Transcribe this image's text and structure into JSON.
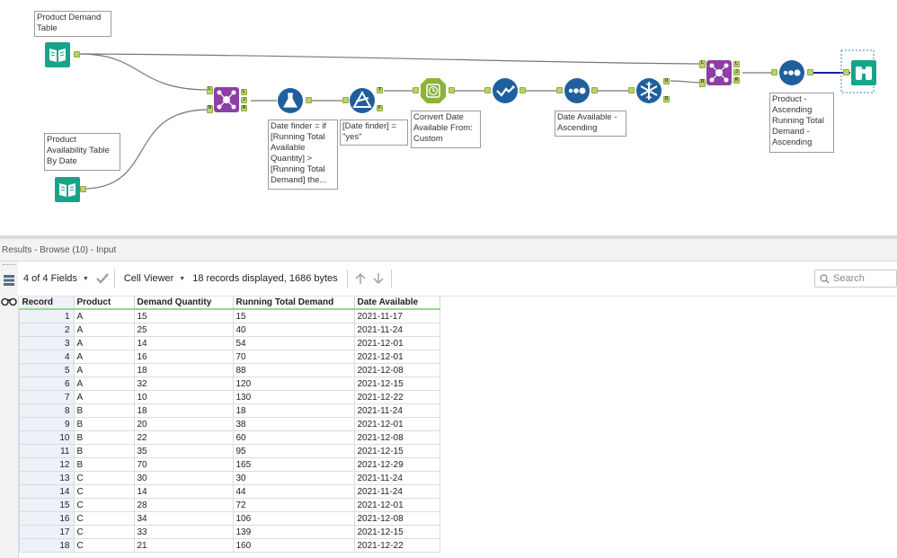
{
  "workflow": {
    "annotations": {
      "input1": "Product Demand Table",
      "input2": "Product Availability Table By Date",
      "formula": "Date finder = if [Running Total Available Quantity] > [Running Total Demand] the...",
      "filter": "[Date finder] = \"yes\"",
      "datetime": "Convert Date Available From: Custom",
      "sort1": "Date Available - Ascending",
      "sort2": "Product - Ascending Running Total Demand - Ascending"
    },
    "anchors": {
      "L": "L",
      "R": "R",
      "J": "J",
      "T": "T",
      "F": "F",
      "U": "U",
      "D": "D"
    },
    "colors": {
      "input": "#17a589",
      "join": "#8e3fa5",
      "blue": "#1f5f9e",
      "datetime": "#8bb33a",
      "wire": "#777777",
      "wire_selected": "#1d1f9b"
    }
  },
  "results": {
    "title": "Results - Browse (10) - Input",
    "toolbar": {
      "fields": "4 of 4 Fields",
      "viewer": "Cell Viewer",
      "records": "18 records displayed, 1686 bytes",
      "search_placeholder": "Search"
    },
    "columns": [
      "Record",
      "Product",
      "Demand Quantity",
      "Running Total Demand",
      "Date Available"
    ],
    "rows": [
      [
        "1",
        "A",
        "15",
        "15",
        "2021-11-17"
      ],
      [
        "2",
        "A",
        "25",
        "40",
        "2021-11-24"
      ],
      [
        "3",
        "A",
        "14",
        "54",
        "2021-12-01"
      ],
      [
        "4",
        "A",
        "16",
        "70",
        "2021-12-01"
      ],
      [
        "5",
        "A",
        "18",
        "88",
        "2021-12-08"
      ],
      [
        "6",
        "A",
        "32",
        "120",
        "2021-12-15"
      ],
      [
        "7",
        "A",
        "10",
        "130",
        "2021-12-22"
      ],
      [
        "8",
        "B",
        "18",
        "18",
        "2021-11-24"
      ],
      [
        "9",
        "B",
        "20",
        "38",
        "2021-12-01"
      ],
      [
        "10",
        "B",
        "22",
        "60",
        "2021-12-08"
      ],
      [
        "11",
        "B",
        "35",
        "95",
        "2021-12-15"
      ],
      [
        "12",
        "B",
        "70",
        "165",
        "2021-12-29"
      ],
      [
        "13",
        "C",
        "30",
        "30",
        "2021-11-24"
      ],
      [
        "14",
        "C",
        "14",
        "44",
        "2021-11-24"
      ],
      [
        "15",
        "C",
        "28",
        "72",
        "2021-12-01"
      ],
      [
        "16",
        "C",
        "34",
        "106",
        "2021-12-08"
      ],
      [
        "17",
        "C",
        "33",
        "139",
        "2021-12-15"
      ],
      [
        "18",
        "C",
        "21",
        "160",
        "2021-12-22"
      ]
    ]
  }
}
